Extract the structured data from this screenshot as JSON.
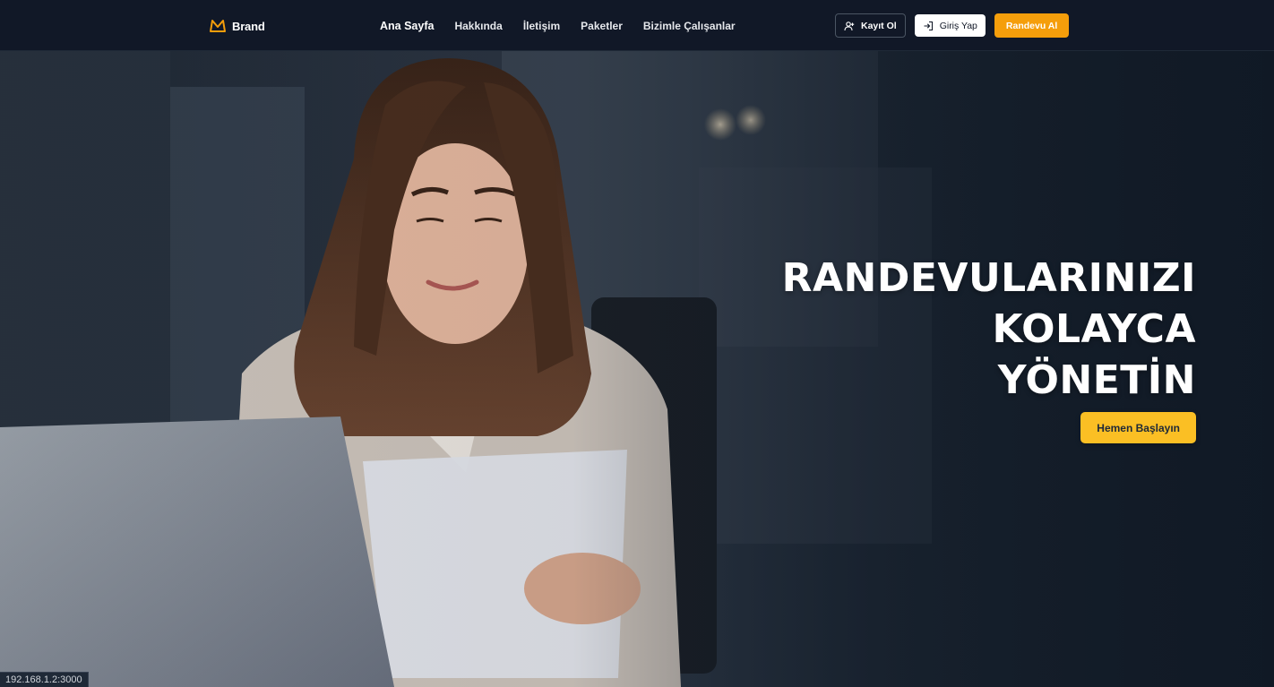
{
  "brand": {
    "name": "Brand",
    "accent": "#f59e0b"
  },
  "nav": {
    "links": [
      {
        "label": "Ana Sayfa",
        "active": true
      },
      {
        "label": "Hakkında"
      },
      {
        "label": "İletişim"
      },
      {
        "label": "Paketler"
      },
      {
        "label": "Bizimle Çalışanlar"
      }
    ]
  },
  "auth": {
    "register_label": "Kayıt Ol",
    "login_label": "Giriş Yap",
    "appointment_label": "Randevu Al"
  },
  "hero": {
    "title_lines": [
      "RANDEVULARINIZI",
      "KOLAYCA",
      "YÖNETİN"
    ],
    "cta_label": "Hemen Başlayın"
  },
  "status_bar": {
    "url": "192.168.1.2:3000"
  },
  "colors": {
    "nav_bg": "#111827",
    "cta_yellow": "#fbbf24",
    "orange": "#f59e0b",
    "text_white": "#ffffff"
  }
}
